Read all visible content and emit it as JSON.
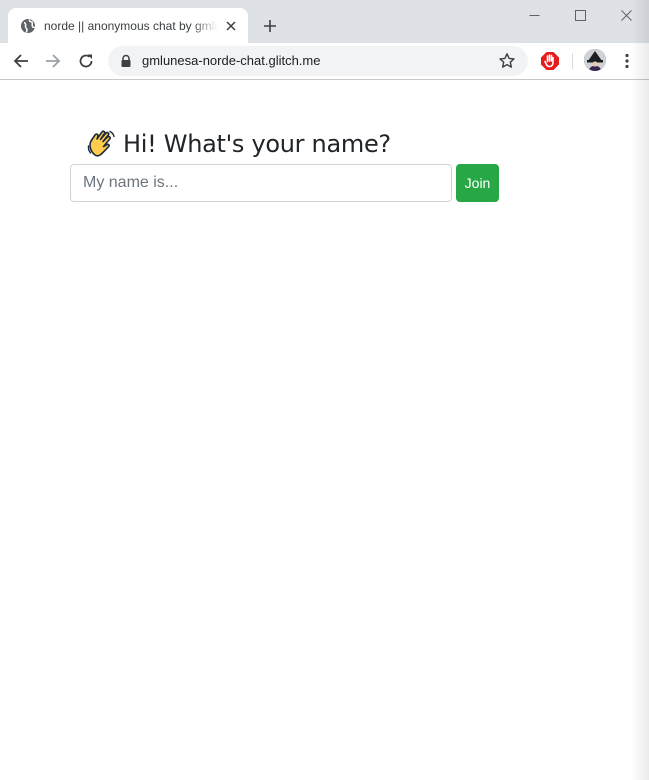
{
  "browser": {
    "tab": {
      "title": "norde || anonymous chat by gmlunesa",
      "favicon": "globe-icon"
    },
    "url": "gmlunesa-norde-chat.glitch.me",
    "icons": {
      "back": "arrow-left-icon",
      "forward": "arrow-right-icon",
      "reload": "reload-icon",
      "lock": "lock-icon",
      "bookmark": "star-icon",
      "extension": "ublock-stop-icon",
      "profile": "avatar",
      "menu": "kebab-menu-icon",
      "new_tab": "plus-icon",
      "close_tab": "close-icon"
    },
    "colors": {
      "tabstrip": "#dee1e6",
      "omnibox": "#f1f3f4",
      "extension": "#e51d1d"
    }
  },
  "page": {
    "heading": {
      "emoji": "waving-hand-icon",
      "text": "Hi! What's your name?"
    },
    "name_input": {
      "placeholder": "My name is...",
      "value": ""
    },
    "join_button": {
      "label": "Join",
      "color": "#28a745"
    }
  }
}
